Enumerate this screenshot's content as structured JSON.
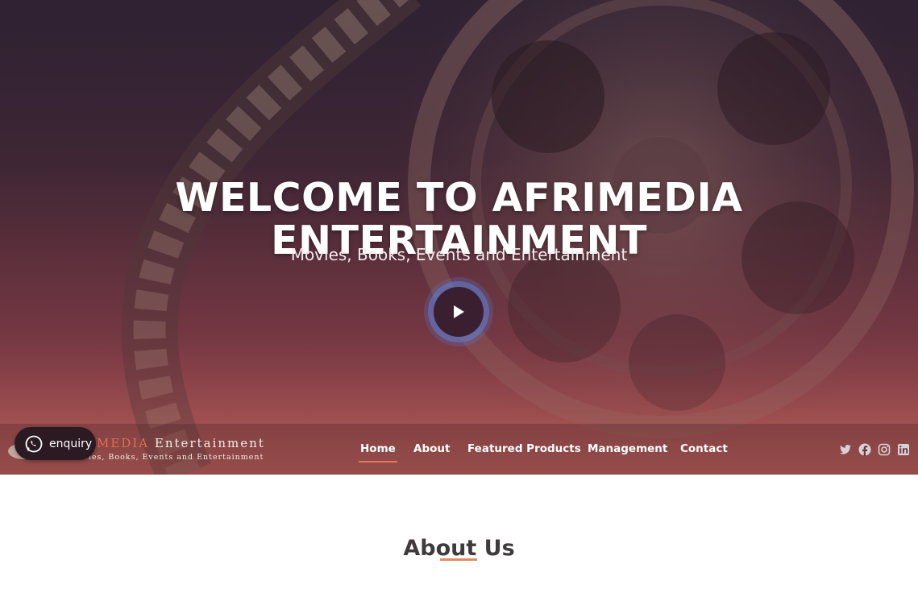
{
  "hero": {
    "title_line1": "WELCOME TO AFRIMEDIA",
    "title_line2": "ENTERTAINMENT",
    "subtitle": "Movies, Books, Events and Entertainment",
    "play_icon": "play-icon"
  },
  "brand": {
    "name_accent": "MEDIA",
    "name_rest": "Entertainment",
    "tagline": "Movies, Books, Events and Entertainment"
  },
  "enquiry": {
    "label": "enquiry",
    "icon": "whatsapp-icon"
  },
  "nav": {
    "items": [
      {
        "label": "Home",
        "active": true
      },
      {
        "label": "About",
        "active": false
      },
      {
        "label": "Featured Products",
        "active": false
      },
      {
        "label": "Management",
        "active": false
      },
      {
        "label": "Contact",
        "active": false
      }
    ]
  },
  "socials": [
    "twitter-icon",
    "facebook-icon",
    "instagram-icon",
    "linkedin-icon"
  ],
  "about": {
    "title": "About Us"
  },
  "colors": {
    "accent": "#e07a55",
    "nav_text": "#ffffff",
    "heading": "#3f3a3b"
  }
}
